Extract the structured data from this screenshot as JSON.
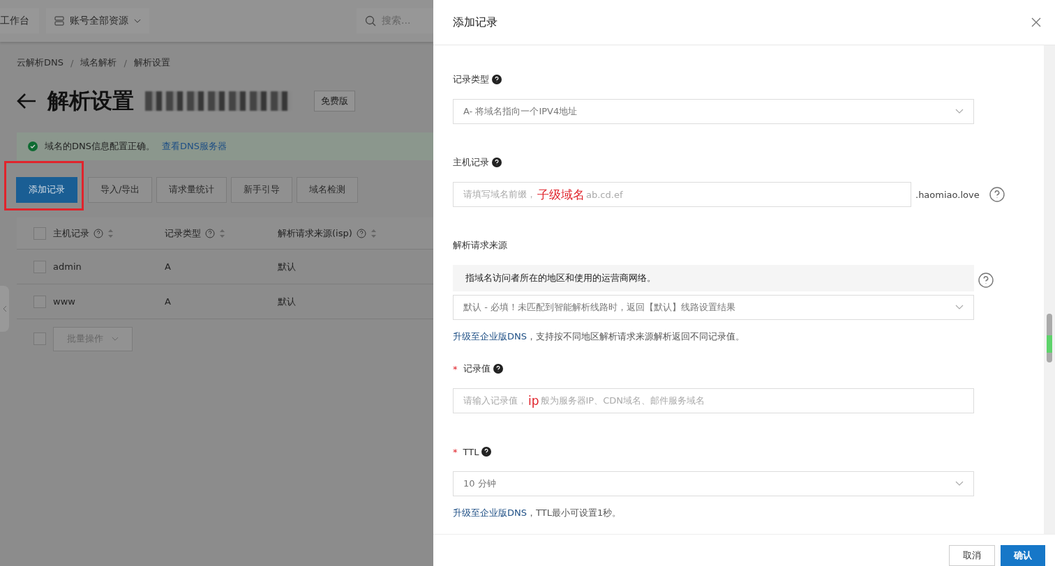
{
  "topbar": {
    "workbench": "工作台",
    "resources": "账号全部资源",
    "search_placeholder": "搜索..."
  },
  "breadcrumb": [
    "云解析DNS",
    "域名解析",
    "解析设置"
  ],
  "breadcrumb_separator": "/",
  "page": {
    "title": "解析设置",
    "badge": "免费版"
  },
  "alert": {
    "text": "域名的DNS信息配置正确。",
    "link": "查看DNS服务器"
  },
  "toolbar": [
    {
      "label": "添加记录",
      "kind": "primary",
      "annotated": true
    },
    {
      "label": "导入/导出",
      "kind": "default",
      "annotated": false
    },
    {
      "label": "请求量统计",
      "kind": "default",
      "annotated": false
    },
    {
      "label": "新手引导",
      "kind": "default",
      "annotated": false
    },
    {
      "label": "域名检测",
      "kind": "default",
      "annotated": false
    }
  ],
  "table": {
    "columns": [
      "主机记录",
      "记录类型",
      "解析请求来源(isp)"
    ],
    "rows": [
      {
        "checked": false,
        "cells": [
          "admin",
          "A",
          "默认"
        ]
      },
      {
        "checked": false,
        "cells": [
          "www",
          "A",
          "默认"
        ]
      }
    ],
    "batch": "批量操作",
    "select_all_checked": false,
    "batch_checked": false
  },
  "drawer": {
    "title": "添加记录",
    "required_mark": "*",
    "fields": [
      {
        "kind": "select",
        "label": "记录类型",
        "required": false,
        "help": true,
        "value": "A- 将域名指向一个IPV4地址"
      },
      {
        "kind": "input",
        "label": "主机记录",
        "required": false,
        "help": true,
        "placeholder": "请填写域名前缀，",
        "annotation": "子级域名",
        "placeholder_tail": "ab.cd.ef",
        "suffix": ".haomiao.love",
        "side_help": true
      },
      {
        "kind": "select",
        "label": "解析请求来源",
        "required": false,
        "help": false,
        "description": "指域名访问者所在的地区和使用的运营商网络。",
        "side_help": true,
        "value": "默认 - 必填！未匹配到智能解析线路时，返回【默认】线路设置结果",
        "note_link": "升级至企业版DNS",
        "note": "，支持按不同地区解析请求来源解析返回不同记录值。"
      },
      {
        "kind": "input",
        "label": "记录值",
        "required": true,
        "help": true,
        "placeholder": "请输入记录值，",
        "annotation": "ip",
        "placeholder_tail": "般为服务器IP、CDN域名、邮件服务域名"
      },
      {
        "kind": "select",
        "label": "TTL",
        "required": true,
        "help": true,
        "value": "10 分钟",
        "note_link": "升级至企业版DNS",
        "note": "，TTL最小可设置1秒。"
      }
    ],
    "buttons": [
      {
        "label": "取消",
        "kind": "default"
      },
      {
        "label": "确认",
        "kind": "primary"
      }
    ]
  }
}
